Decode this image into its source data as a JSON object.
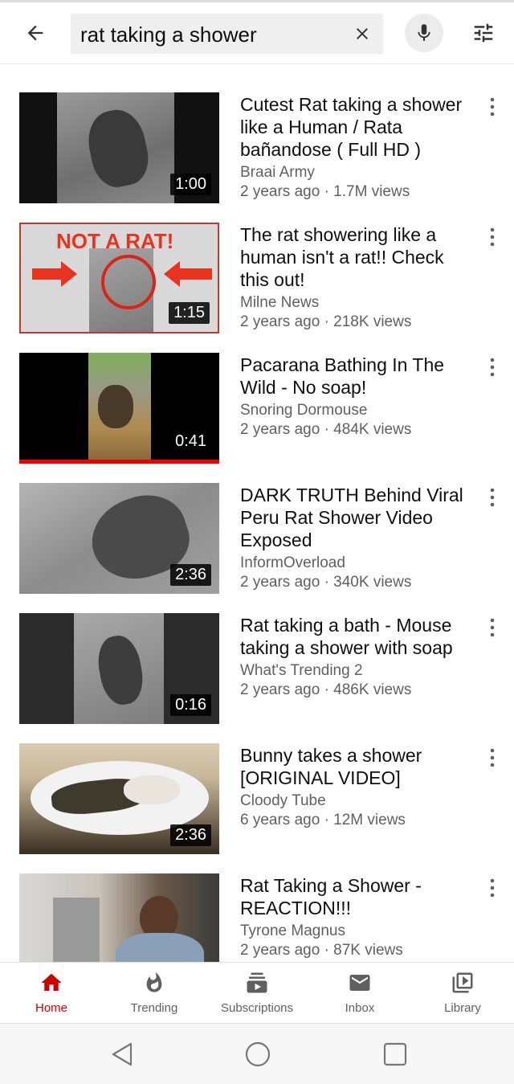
{
  "search": {
    "query": "rat taking a shower"
  },
  "results": [
    {
      "title": "Cutest Rat taking a shower like a Human / Rata bañandose ( Full HD )",
      "channel": "Braai Army",
      "meta": "2 years ago · 1.7M views",
      "duration": "1:00"
    },
    {
      "title": "The rat showering like a human isn't a rat!! Check this out!",
      "channel": "Milne News",
      "meta": "2 years ago · 218K views",
      "duration": "1:15",
      "thumb_text": "NOT A RAT!"
    },
    {
      "title": "Pacarana Bathing In The Wild - No soap!",
      "channel": "Snoring Dormouse",
      "meta": "2 years ago · 484K views",
      "duration": "0:41"
    },
    {
      "title": "DARK TRUTH Behind Viral Peru Rat Shower Video Exposed",
      "channel": "InformOverload",
      "meta": "2 years ago · 340K views",
      "duration": "2:36"
    },
    {
      "title": "Rat taking a bath - Mouse taking a shower with soap",
      "channel": "What's Trending 2",
      "meta": "2 years ago · 486K views",
      "duration": "0:16"
    },
    {
      "title": "Bunny takes a shower [ORIGINAL VIDEO]",
      "channel": "Cloody Tube",
      "meta": "6 years ago · 12M views",
      "duration": "2:36"
    },
    {
      "title": "Rat Taking a Shower - REACTION!!!",
      "channel": "Tyrone Magnus",
      "meta": "2 years ago · 87K views",
      "duration": ""
    }
  ],
  "bottom_nav": [
    {
      "label": "Home",
      "icon": "home-icon"
    },
    {
      "label": "Trending",
      "icon": "trending-icon"
    },
    {
      "label": "Subscriptions",
      "icon": "subscriptions-icon"
    },
    {
      "label": "Inbox",
      "icon": "inbox-icon"
    },
    {
      "label": "Library",
      "icon": "library-icon"
    }
  ],
  "colors": {
    "accent": "#cc0000",
    "secondary_text": "#606060"
  }
}
